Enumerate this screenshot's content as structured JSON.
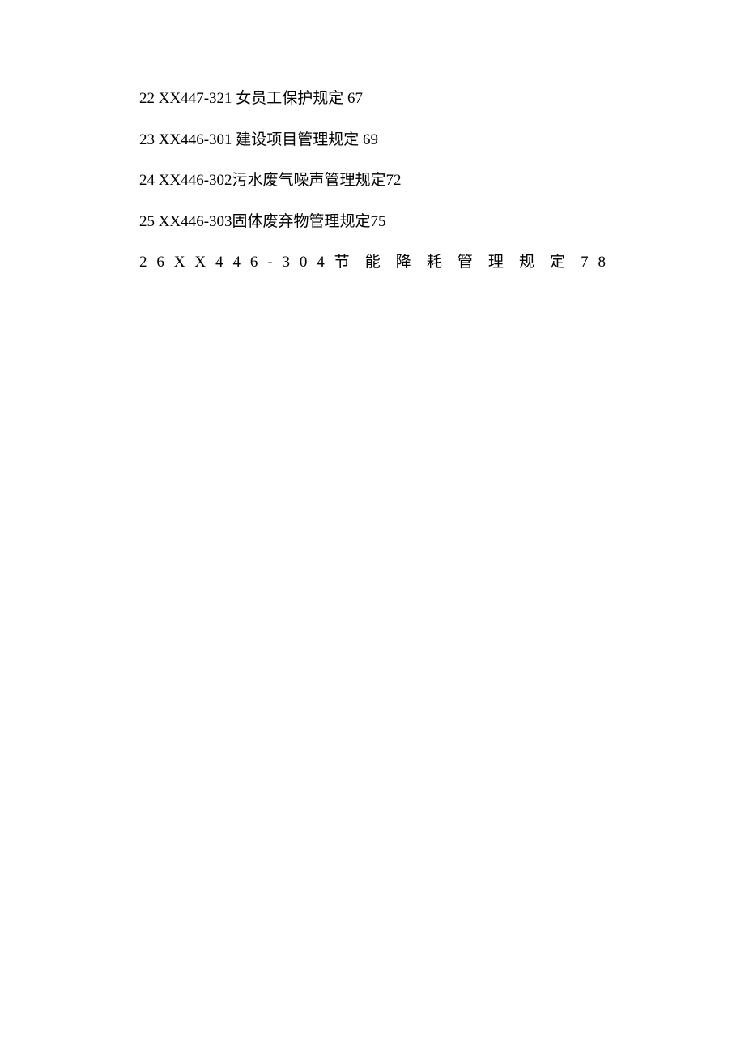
{
  "toc": {
    "entries": [
      {
        "index": "22",
        "code": "XX447-321",
        "title": "女员工保护规定",
        "page": "67",
        "spaced_code": true,
        "spaced_title": true
      },
      {
        "index": "23",
        "code": "XX446-301",
        "title": "建设项目管理规定",
        "page": "69",
        "spaced_code": true,
        "spaced_title": true
      },
      {
        "index": "24",
        "code": "XX446-302",
        "title": "污水废气噪声管理规定",
        "page": "72",
        "spaced_code": false,
        "spaced_title": false
      },
      {
        "index": "25",
        "code": "XX446-303",
        "title": "固体废弃物管理规定",
        "page": "75",
        "spaced_code": false,
        "spaced_title": false
      },
      {
        "index": "26",
        "code": "XX446-304",
        "title": "节能降耗管理规定",
        "page": "78",
        "justified": true
      }
    ]
  }
}
